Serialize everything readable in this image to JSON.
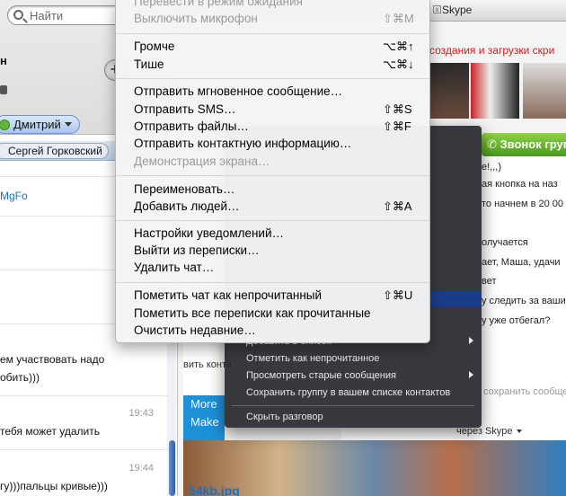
{
  "sidebar": {
    "search_placeholder": "Найти",
    "top_letter": "н",
    "user_name": "Дмитрий",
    "tab_contact": "Сергей Горковский",
    "link_fragment": "MgFo",
    "messages": [
      {
        "text": "ем участвовать надо",
        "time": ""
      },
      {
        "text": "обить)))",
        "time": ""
      },
      {
        "text": "тебя может удалить",
        "time": "19:43"
      },
      {
        "text": "гу)))пальцы кривые)))",
        "time": "19:44"
      }
    ]
  },
  "background": {
    "tab_title": "Skype",
    "promo_link": "создания и загрузки скри",
    "group_button": "Звонок групп",
    "chat_lines": [
      {
        "text": "е!,,,)"
      },
      {
        "text": "ая кнопка на наз"
      },
      {
        "text": "то начнем в 20 00"
      },
      {
        "text": "олучается"
      },
      {
        "text": "ает, Маша, удачи"
      },
      {
        "text": "вет"
      },
      {
        "text": "у следить за ваши"
      },
      {
        "text": "у уже отбегал?"
      }
    ],
    "send_placeholder": "сохранить сообщение",
    "via_skype": "через Skype",
    "send_contact": "вить конта",
    "more": "More",
    "make": "Make",
    "file_name": "54kb.jpg"
  },
  "context_menu_secondary": {
    "items": [
      {
        "label": "Добавить в список",
        "arrow": true
      },
      {
        "label": "Отметить как непрочитанное",
        "arrow": false
      },
      {
        "label": "Просмотреть старые сообщения",
        "arrow": true
      },
      {
        "label": "Сохранить группу в вашем списке контактов",
        "arrow": false
      },
      {
        "label": "Скрыть разговор",
        "arrow": false
      }
    ]
  },
  "context_menu": {
    "groups": [
      [
        {
          "label": "Перевести в режим ожидания",
          "shortcut": "",
          "disabled": true
        },
        {
          "label": "Выключить микрофон",
          "shortcut": "⇧⌘M",
          "disabled": true
        }
      ],
      [
        {
          "label": "Громче",
          "shortcut": "⌥⌘↑",
          "disabled": false
        },
        {
          "label": "Тише",
          "shortcut": "⌥⌘↓",
          "disabled": false
        }
      ],
      [
        {
          "label": "Отправить мгновенное сообщение…",
          "shortcut": "",
          "disabled": false
        },
        {
          "label": "Отправить SMS…",
          "shortcut": "⇧⌘S",
          "disabled": false
        },
        {
          "label": "Отправить файлы…",
          "shortcut": "⇧⌘F",
          "disabled": false
        },
        {
          "label": "Отправить контактную информацию…",
          "shortcut": "",
          "disabled": false
        },
        {
          "label": "Демонстрация экрана…",
          "shortcut": "",
          "disabled": true
        }
      ],
      [
        {
          "label": "Переименовать…",
          "shortcut": "",
          "disabled": false
        },
        {
          "label": "Добавить людей…",
          "shortcut": "⇧⌘A",
          "disabled": false
        }
      ],
      [
        {
          "label": "Настройки уведомлений…",
          "shortcut": "",
          "disabled": false
        },
        {
          "label": "Выйти из переписки…",
          "shortcut": "",
          "disabled": false
        },
        {
          "label": "Удалить чат…",
          "shortcut": "",
          "disabled": false
        }
      ],
      [
        {
          "label": "Пометить чат как непрочитанный",
          "shortcut": "⇧⌘U",
          "disabled": false
        },
        {
          "label": "Пометить все переписки как прочитанные",
          "shortcut": "",
          "disabled": false
        },
        {
          "label": "Очистить недавние…",
          "shortcut": "",
          "disabled": false
        }
      ]
    ]
  }
}
